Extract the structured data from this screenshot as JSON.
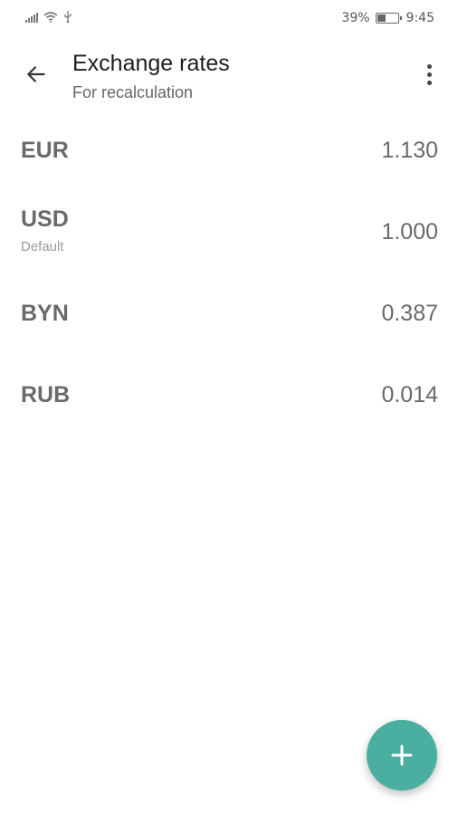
{
  "status_bar": {
    "battery_percent": "39%",
    "battery_level": 0.39,
    "time": "9:45",
    "icons": [
      "signal-icon",
      "wifi-icon",
      "usb-icon",
      "battery-icon"
    ]
  },
  "app_bar": {
    "title": "Exchange rates",
    "subtitle": "For recalculation",
    "back_icon": "arrow-back-icon",
    "menu_icon": "more-vert-icon"
  },
  "rates": [
    {
      "code": "EUR",
      "rate": "1.130",
      "note": ""
    },
    {
      "code": "USD",
      "rate": "1.000",
      "note": "Default"
    },
    {
      "code": "BYN",
      "rate": "0.387",
      "note": ""
    },
    {
      "code": "RUB",
      "rate": "0.014",
      "note": ""
    }
  ],
  "fab": {
    "icon": "plus-icon",
    "color": "#4aaea0"
  },
  "colors": {
    "accent": "#4aaea0",
    "text_muted": "#6a6a6a"
  }
}
